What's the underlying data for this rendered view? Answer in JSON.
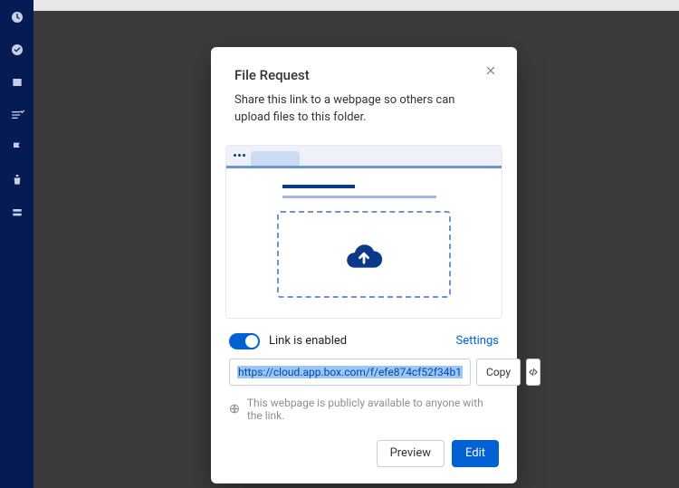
{
  "sidebar": {
    "icons": [
      "clock-icon",
      "check-circle-icon",
      "book-icon",
      "checklist-icon",
      "flag-icon",
      "trash-icon",
      "layers-icon"
    ]
  },
  "modal": {
    "title": "File Request",
    "subtitle": "Share this link to a webpage so others can upload files to this folder.",
    "link_status": "Link is enabled",
    "settings_label": "Settings",
    "url_value": "https://cloud.app.box.com/f/efe874cf52f34b1",
    "copy_label": "Copy",
    "public_note": "This webpage is publicly available to anyone with the link.",
    "preview_label": "Preview",
    "edit_label": "Edit"
  }
}
